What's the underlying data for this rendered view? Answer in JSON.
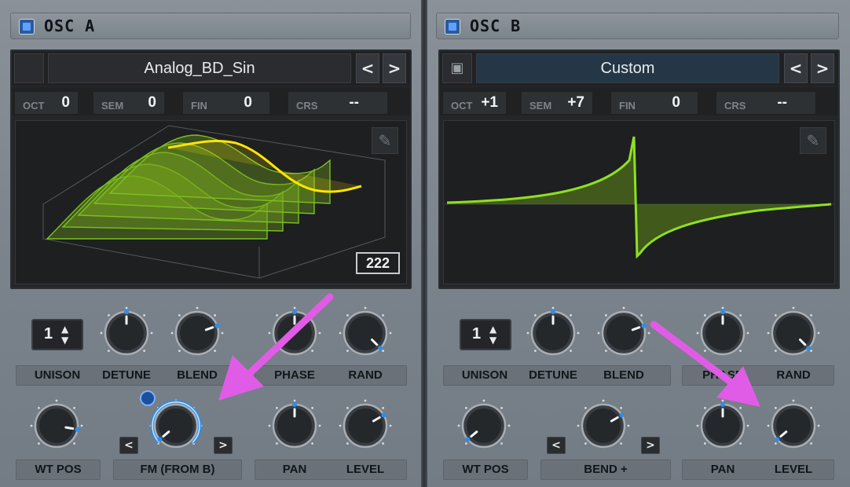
{
  "oscA": {
    "title": "OSC A",
    "wavetable_name": "Analog_BD_Sin",
    "prev_label": "<",
    "next_label": ">",
    "pitch": [
      {
        "label": "OCT",
        "value": "0"
      },
      {
        "label": "SEM",
        "value": "0"
      },
      {
        "label": "FIN",
        "value": "0"
      },
      {
        "label": "CRS",
        "value": "--"
      }
    ],
    "frame_count": "222",
    "unison": "1",
    "labels": {
      "unison": "UNISON",
      "detune": "DETUNE",
      "blend": "BLEND",
      "phase": "PHASE",
      "rand": "RAND",
      "wt_pos": "WT POS",
      "fm": "FM (FROM B)",
      "pan": "PAN",
      "level": "LEVEL"
    },
    "fm_prev": "<",
    "fm_next": ">"
  },
  "oscB": {
    "title": "OSC B",
    "wavetable_name": "Custom",
    "prev_label": "<",
    "next_label": ">",
    "pitch": [
      {
        "label": "OCT",
        "value": "+1"
      },
      {
        "label": "SEM",
        "value": "+7"
      },
      {
        "label": "FIN",
        "value": "0"
      },
      {
        "label": "CRS",
        "value": "--"
      }
    ],
    "unison": "1",
    "labels": {
      "unison": "UNISON",
      "detune": "DETUNE",
      "blend": "BLEND",
      "phase": "PHASE",
      "rand": "RAND",
      "wt_pos": "WT POS",
      "bend": "BEND +",
      "pan": "PAN",
      "level": "LEVEL"
    },
    "bend_prev": "<",
    "bend_next": ">"
  },
  "colors": {
    "waveform_green": "#8fe022",
    "waveform_highlight": "#ffe600",
    "knob_indicator_blue": "#2d8ee8",
    "annotation_arrow": "#e05ce6"
  }
}
